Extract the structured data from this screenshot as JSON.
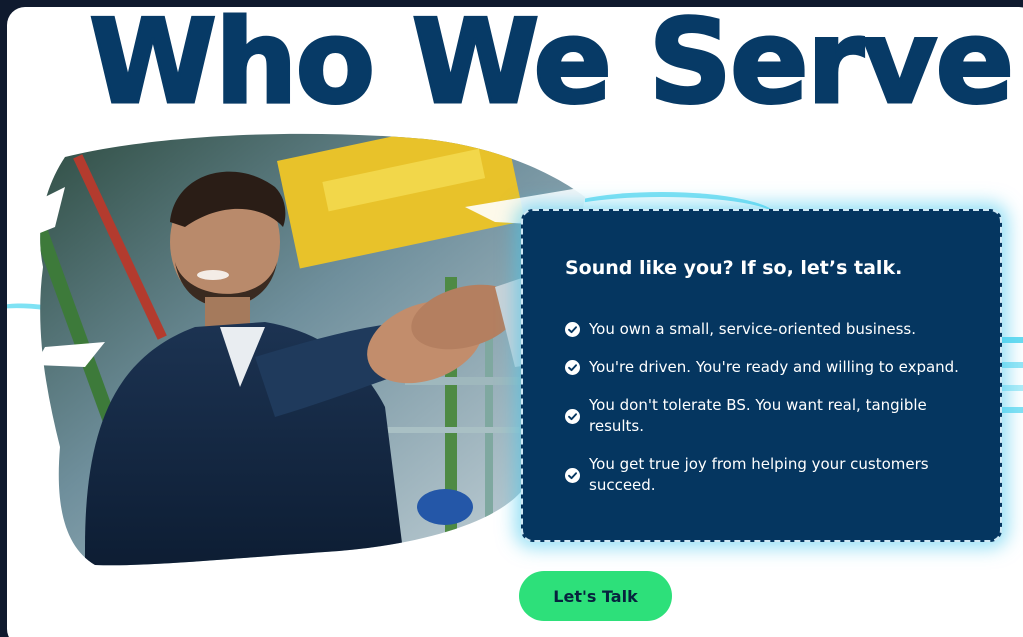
{
  "hero": {
    "title": "Who We Serve"
  },
  "info": {
    "heading": "Sound like you? If so, let’s talk.",
    "bullets": [
      "You own a small, service-oriented business.",
      "You're driven. You're ready and willing to expand.",
      "You don't tolerate BS. You want real, tangible results.",
      "You get true joy from helping your customers succeed."
    ],
    "bullet_icon": "check-circle-icon"
  },
  "cta": {
    "label": "Let's Talk"
  },
  "colors": {
    "page_background": "#0f1a2e",
    "title": "#073a66",
    "box_background": "#053660",
    "box_glow": "#40c6ec",
    "cta_background": "#2de07a",
    "accent_cyan": "#4fd6ef"
  }
}
